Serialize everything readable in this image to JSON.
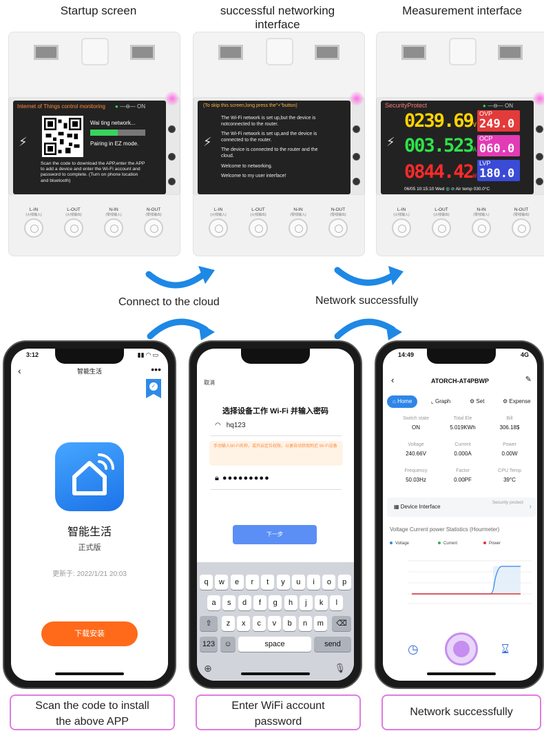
{
  "stages": {
    "startup_title": "Startup screen",
    "networking_title": "successful networking interface",
    "measurement_title": "Measurement interface"
  },
  "screen1": {
    "header": "Internet of Things control monitoring",
    "status": "ON",
    "waiting": "Wai ting network...",
    "progress": 0.5,
    "pairing": "Pairing in EZ mode.",
    "instructions": "Scan the code to download the APP,enter the APP to add a device and enter the Wi-Fi account and password to complete. (Turn on phone location and bluetooth)"
  },
  "screen2": {
    "header": "(To skip this screen,long press the\"+\"button)",
    "lines": [
      "The Wi-Fi network is set up,but the device is notconnected to the router.",
      "The Wi-Fi network is set up,and the device is connected to the router.",
      "The device is connected to the router and the cloud.",
      "Welcome to networking.",
      "Welcome to my user interface!"
    ]
  },
  "screen3": {
    "header": "SecurityProtect",
    "status": "ON",
    "voltage": "0239.69",
    "voltage_unit": "V",
    "current": "003.523",
    "current_unit": "A",
    "power": "0844.42",
    "power_unit": "W",
    "ovp_label": "OVP",
    "ovp_value": "249.0",
    "ocp_label": "OCP",
    "ocp_value": "060.0",
    "lvp_label": "LVP",
    "lvp_value": "180.0",
    "footer": "06/05  10:15:10 Wed",
    "temp": "Air temp 030.0°C",
    "colors": {
      "voltage": "#ffd400",
      "current": "#2ee24a",
      "power": "#ff2a2a"
    }
  },
  "terminals": [
    "L-IN",
    "L-OUT",
    "N-IN",
    "N-OUT"
  ],
  "terminal_subs": [
    "(火线输入)",
    "(火线输出)",
    "(零线输入)",
    "(零线输出)"
  ],
  "flow": {
    "connect_label": "Connect to the cloud",
    "network_label": "Network successfully"
  },
  "phone1": {
    "time": "3:12",
    "title": "智能生活",
    "app_name": "智能生活",
    "version": "正式版",
    "updated": "更新于: 2022/1/21 20:03",
    "download": "下载安装"
  },
  "phone2": {
    "cancel": "取消",
    "title": "选择设备工作 Wi-Fi 并输入密码",
    "ssid": "hq123",
    "warning": "手动输入Wi-Fi名称，或开启定位权限，以便自动获取附近 Wi-Fi设备",
    "password": "●●●●●●●●●",
    "next": "下一步",
    "rows": [
      [
        "q",
        "w",
        "e",
        "r",
        "t",
        "y",
        "u",
        "i",
        "o",
        "p"
      ],
      [
        "a",
        "s",
        "d",
        "f",
        "g",
        "h",
        "j",
        "k",
        "l"
      ],
      [
        "z",
        "x",
        "c",
        "v",
        "b",
        "n",
        "m"
      ]
    ],
    "key_123": "123",
    "key_space": "space",
    "key_send": "send"
  },
  "phone3": {
    "time": "14:49",
    "network": "4G",
    "title": "ATORCH-AT4PBWP",
    "tabs": [
      "Home",
      "Graph",
      "Set",
      "Expense"
    ],
    "cells": [
      {
        "k": "Switch state",
        "v": "ON"
      },
      {
        "k": "Total Ele",
        "v": "5.019KWh"
      },
      {
        "k": "Bill",
        "v": "306.18$"
      },
      {
        "k": "Voltage",
        "v": "240.66V"
      },
      {
        "k": "Current",
        "v": "0.000A"
      },
      {
        "k": "Power",
        "v": "0.00W"
      },
      {
        "k": "Frequency",
        "v": "50.03Hz"
      },
      {
        "k": "Factor",
        "v": "0.00PF"
      },
      {
        "k": "CPU Temp",
        "v": "39°C"
      }
    ],
    "device_interface": "Device Interface",
    "security": "Security protect",
    "stat_title": "Voltage Current power Statistics (Hourmeter)",
    "legend": [
      "Voltage",
      "Current",
      "Power"
    ],
    "legend_colors": [
      "#2f86e8",
      "#37b24d",
      "#e03131"
    ]
  },
  "captions": {
    "c1": "Scan the code to install the above APP",
    "c2": "Enter WiFi account password",
    "c3": "Network successfully"
  }
}
